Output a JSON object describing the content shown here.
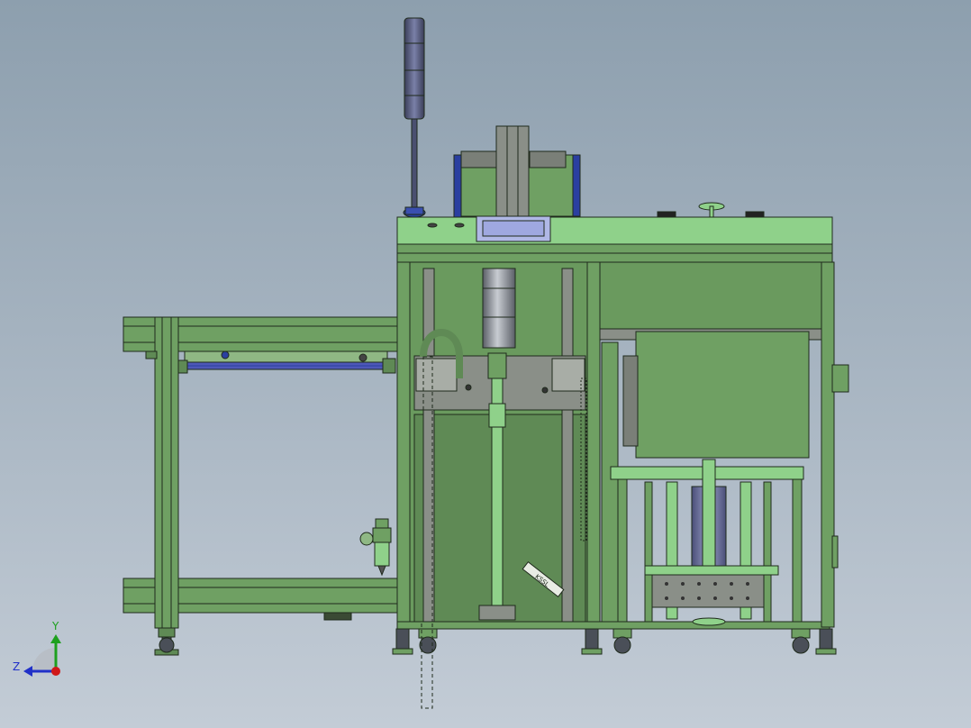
{
  "viewport": {
    "background_top": "#8d9fae",
    "background_bottom": "#c3ccd6"
  },
  "colors": {
    "frame_green": "#5f8a55",
    "light_green": "#8fd18a",
    "mid_green": "#6fa063",
    "outline": "#1f2a1c",
    "blue_frame": "#2a3fa0",
    "gray_metal": "#8a8f88",
    "dark_metal": "#4a4f58",
    "tower_light": "#555a78",
    "display_blue": "#9fa8e0"
  },
  "triad": {
    "y_label": "Y",
    "z_label": "Z",
    "y_color": "#1ea01e",
    "z_color": "#2030c8",
    "origin_color": "#d01818"
  },
  "labels": {
    "marking": "KSSL"
  }
}
